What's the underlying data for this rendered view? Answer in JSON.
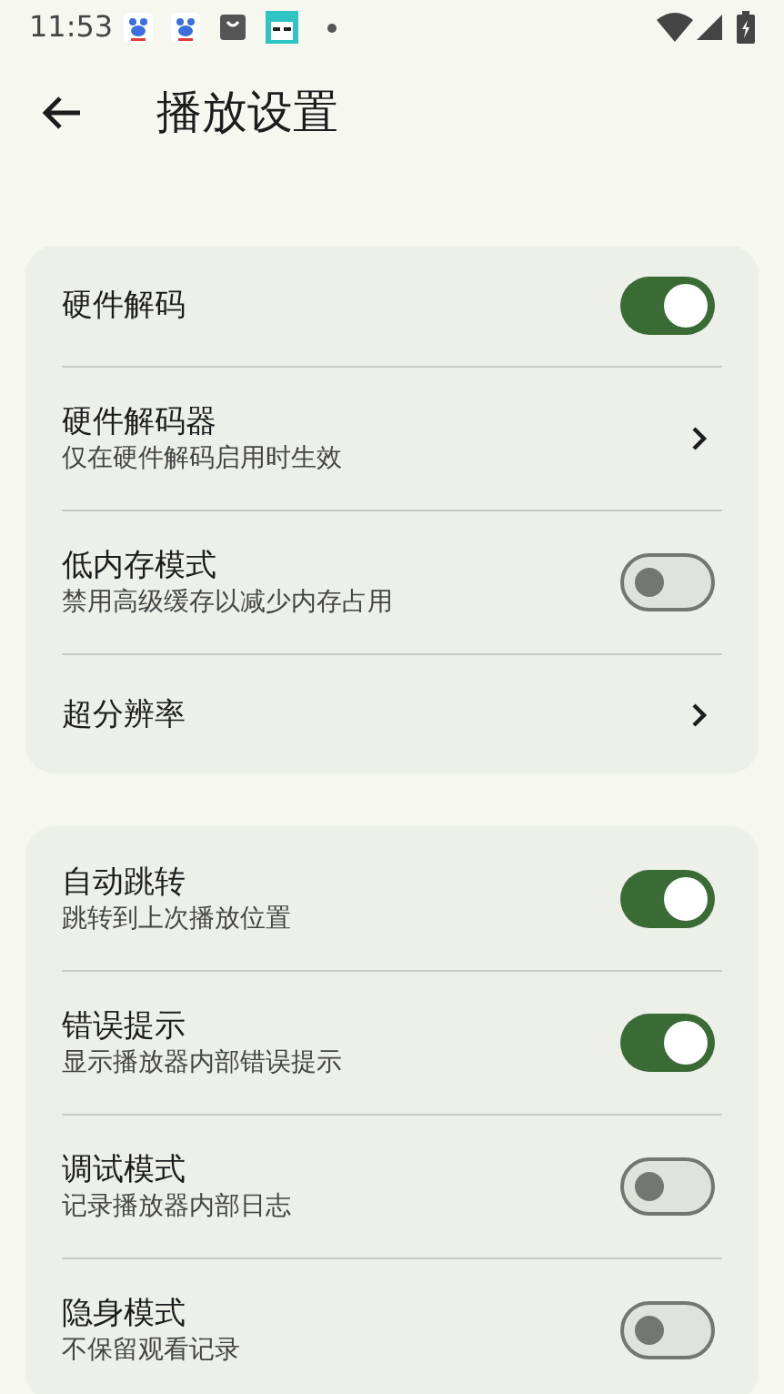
{
  "status_bar": {
    "time": "11:53"
  },
  "header": {
    "title": "播放设置"
  },
  "groups": [
    {
      "items": [
        {
          "kind": "switch",
          "title": "硬件解码",
          "on": true
        },
        {
          "kind": "link",
          "title": "硬件解码器",
          "subtitle": "仅在硬件解码启用时生效"
        },
        {
          "kind": "switch",
          "title": "低内存模式",
          "subtitle": "禁用高级缓存以减少内存占用",
          "on": false
        },
        {
          "kind": "link",
          "title": "超分辨率"
        }
      ]
    },
    {
      "items": [
        {
          "kind": "switch",
          "title": "自动跳转",
          "subtitle": "跳转到上次播放位置",
          "on": true
        },
        {
          "kind": "switch",
          "title": "错误提示",
          "subtitle": "显示播放器内部错误提示",
          "on": true
        },
        {
          "kind": "switch",
          "title": "调试模式",
          "subtitle": "记录播放器内部日志",
          "on": false
        },
        {
          "kind": "switch",
          "title": "隐身模式",
          "subtitle": "不保留观看记录",
          "on": false
        }
      ]
    }
  ]
}
